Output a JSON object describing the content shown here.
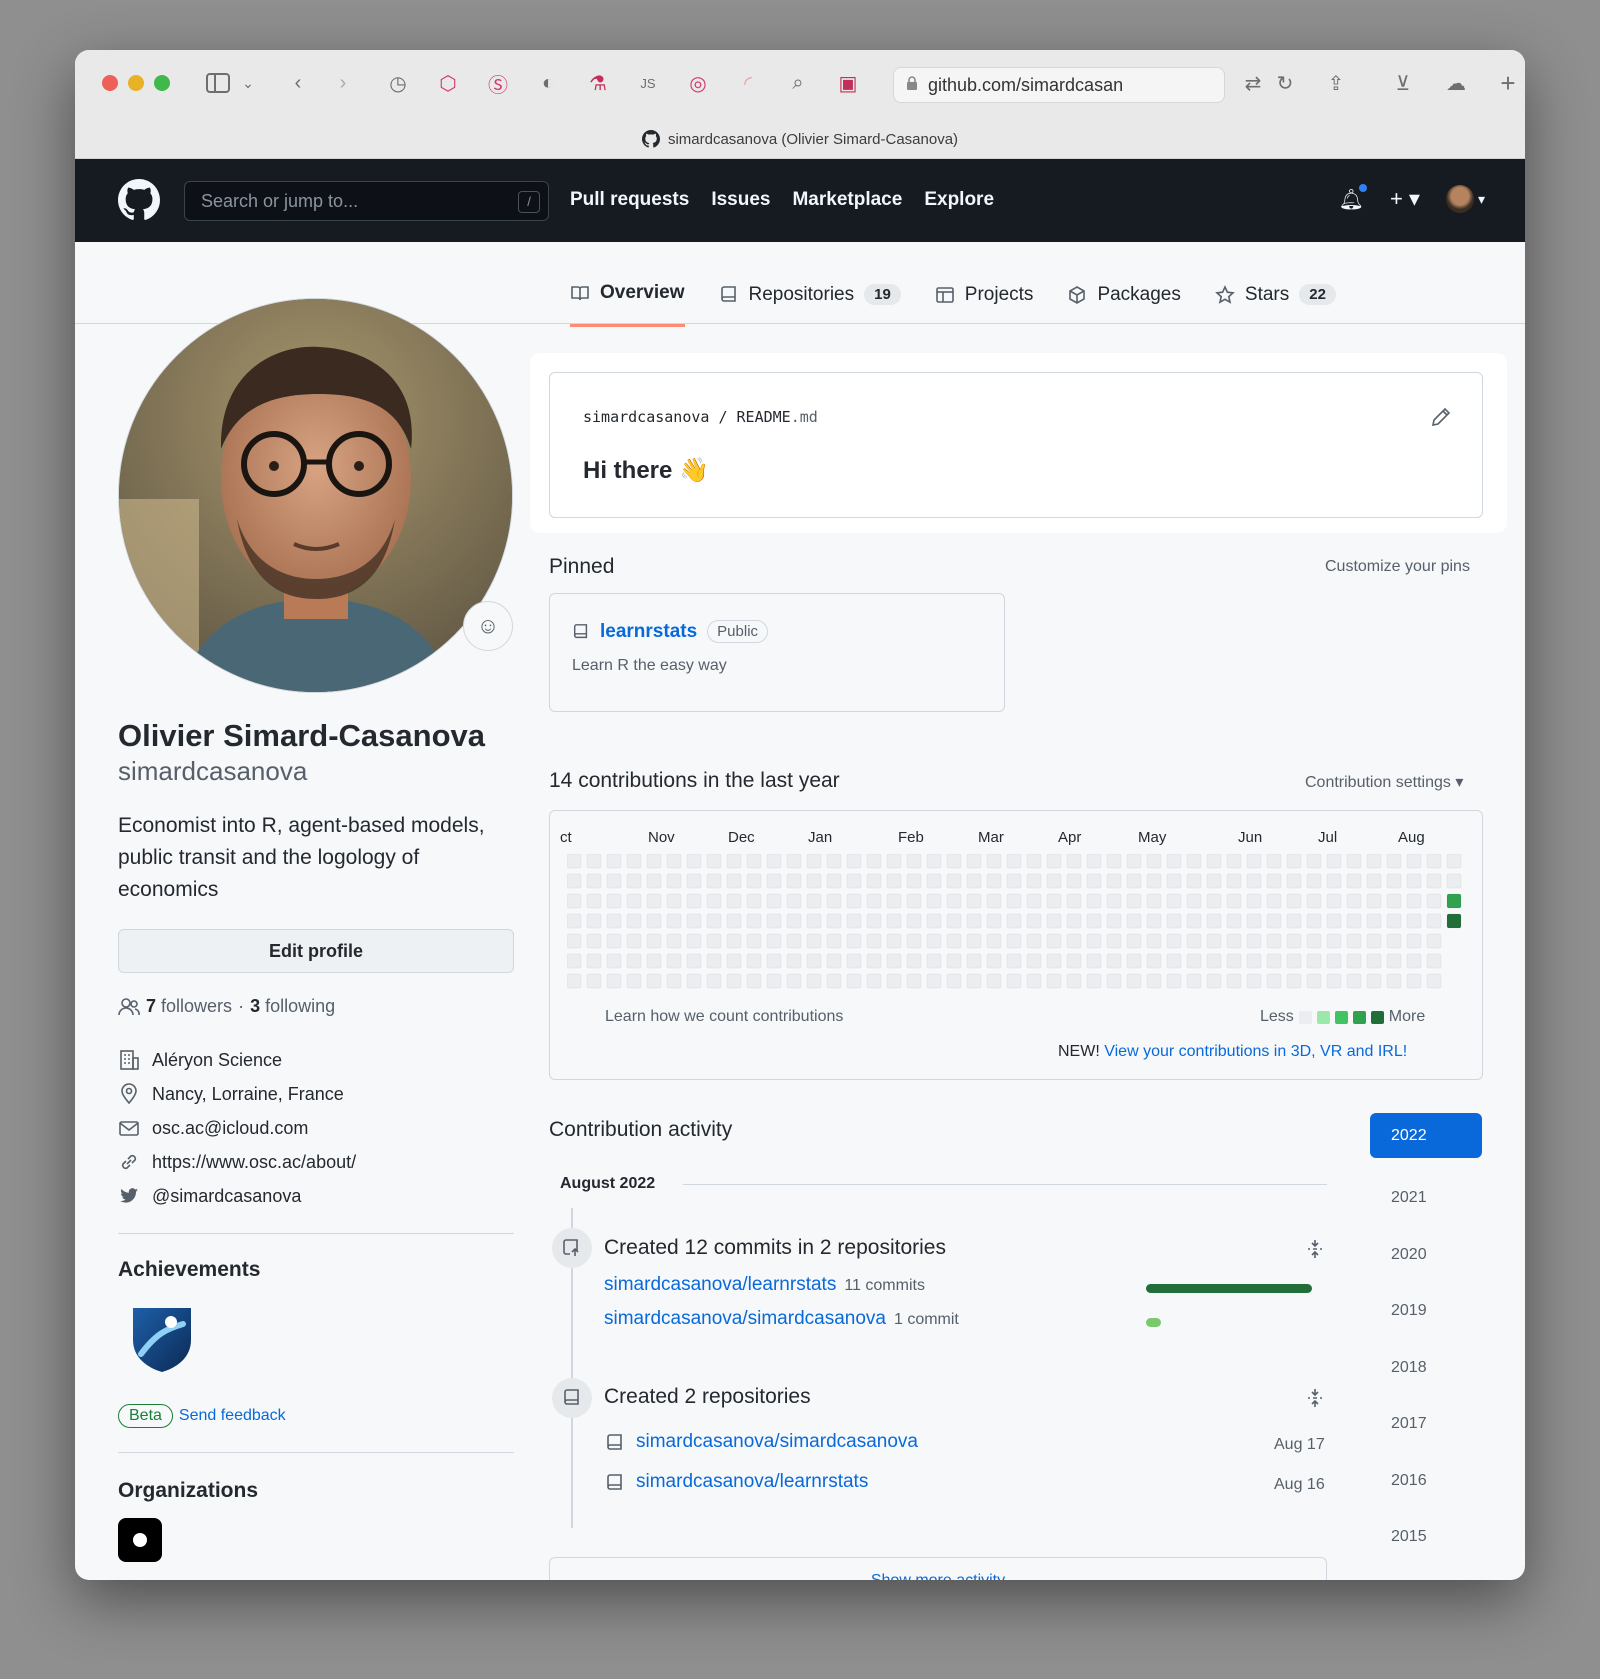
{
  "browser": {
    "url": "github.com/simardcasan",
    "tab_title": "simardcasanova (Olivier Simard-Casanova)"
  },
  "header": {
    "search_placeholder": "Search or jump to...",
    "search_shortcut": "/",
    "nav": [
      "Pull requests",
      "Issues",
      "Marketplace",
      "Explore"
    ]
  },
  "tabs": {
    "overview": "Overview",
    "repositories": "Repositories",
    "repositories_count": "19",
    "projects": "Projects",
    "packages": "Packages",
    "stars": "Stars",
    "stars_count": "22"
  },
  "profile": {
    "name": "Olivier Simard-Casanova",
    "login": "simardcasanova",
    "bio": "Economist into R, agent-based models, public transit and the logology of economics",
    "edit_label": "Edit profile",
    "followers_count": "7",
    "followers_label": "followers",
    "sep": "·",
    "following_count": "3",
    "following_label": "following",
    "company": "Aléryon Science",
    "location": "Nancy, Lorraine, France",
    "email": "osc.ac@icloud.com",
    "website": "https://www.osc.ac/about/",
    "twitter": "@simardcasanova"
  },
  "achievements": {
    "title": "Achievements",
    "beta": "Beta",
    "feedback": "Send feedback"
  },
  "organizations": {
    "title": "Organizations"
  },
  "readme": {
    "owner": "simardcasanova",
    "slash": "/",
    "file": "README",
    "ext": ".md",
    "heading": "Hi there 👋"
  },
  "pinned": {
    "title": "Pinned",
    "customize": "Customize your pins",
    "repo": "learnrstats",
    "visibility": "Public",
    "description": "Learn R the easy way"
  },
  "contributions": {
    "title": "14 contributions in the last year",
    "settings": "Contribution settings",
    "months": [
      "ct",
      "Nov",
      "Dec",
      "Jan",
      "Feb",
      "Mar",
      "Apr",
      "May",
      "Jun",
      "Jul",
      "Aug"
    ],
    "learn": "Learn how we count contributions",
    "less": "Less",
    "more": "More",
    "new_prefix": "NEW!",
    "new_link": "View your contributions in 3D, VR and IRL!",
    "legend_colors": [
      "#ebedf0",
      "#9be9a8",
      "#40c463",
      "#30a14e",
      "#216e39"
    ]
  },
  "activity": {
    "title": "Contribution activity",
    "month": "August 2022",
    "years": [
      "2022",
      "2021",
      "2020",
      "2019",
      "2018",
      "2017",
      "2016",
      "2015"
    ],
    "commits_title": "Created 12 commits in 2 repositories",
    "commit_repos": [
      {
        "name": "simardcasanova/learnrstats",
        "count": "11 commits",
        "fraction": 1.0
      },
      {
        "name": "simardcasanova/simardcasanova",
        "count": "1 commit",
        "fraction": 0.09
      }
    ],
    "repos_title": "Created 2 repositories",
    "created_repos": [
      {
        "name": "simardcasanova/simardcasanova",
        "date": "Aug 17"
      },
      {
        "name": "simardcasanova/learnrstats",
        "date": "Aug 16"
      }
    ],
    "show_more": "Show more activity"
  }
}
